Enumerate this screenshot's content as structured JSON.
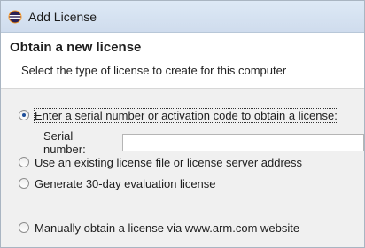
{
  "window": {
    "title": "Add License"
  },
  "banner": {
    "title": "Obtain a new license",
    "description": "Select the type of license to create for this computer"
  },
  "options": [
    {
      "label": "Enter a serial number or activation code to obtain a license:",
      "selected": true
    },
    {
      "label": "Use an existing license file or license server address",
      "selected": false
    },
    {
      "label": "Generate 30-day evaluation license",
      "selected": false
    },
    {
      "label": "Manually obtain a license via www.arm.com website",
      "selected": false
    }
  ],
  "serial": {
    "label": "Serial number:",
    "value": ""
  },
  "colors": {
    "titlebar": "#cfdced",
    "radio_dot": "#1f4f9a"
  }
}
